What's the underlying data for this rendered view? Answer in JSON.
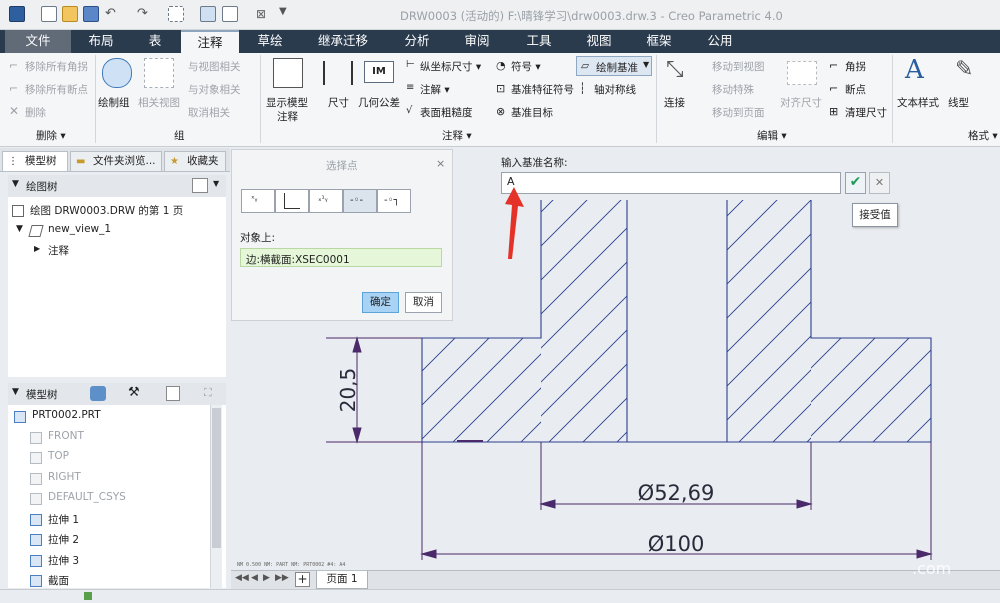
{
  "window": {
    "title": "DRW0003 (活动的) F:\\晴锋学习\\drw0003.drw.3 - Creo Parametric 4.0"
  },
  "tabs": [
    "文件",
    "布局",
    "表",
    "注释",
    "草绘",
    "继承迁移",
    "分析",
    "审阅",
    "工具",
    "视图",
    "框架",
    "公用"
  ],
  "active_tab": "注释",
  "ribbon": {
    "delete_group": {
      "remove_all_angles": "移除所有角拐",
      "remove_all_breaks": "移除所有断点",
      "delete": "删除",
      "label": "删除"
    },
    "group_group": {
      "draw_group": "绘制组",
      "related_view": "相关视图",
      "view_related": "与视图相关",
      "object_related": "与对象相关",
      "cancel_related": "取消相关",
      "label": "组"
    },
    "annotation_group": {
      "show_model_annot_1": "显示模型",
      "show_model_annot_2": "注释",
      "dimension": "尺寸",
      "geometric_tolerance": "几何公差",
      "ordinate_dim": "纵坐标尺寸",
      "annotate": "注解",
      "surface_finish": "表面粗糙度",
      "symbol": "符号",
      "datum_feature_symbol": "基准特征符号",
      "datum_target": "基准目标",
      "draw_datum": "绘制基准",
      "axis_symmetry_line": "轴对称线",
      "label": "注释"
    },
    "edit_group": {
      "connect": "连接",
      "move_to_view": "移动到视图",
      "move_special": "移动特殊",
      "move_to_page": "移动到页面",
      "align_dim": "对齐尺寸",
      "corner": "角拐",
      "breakpoint": "断点",
      "clean_dim": "清理尺寸",
      "label": "编辑"
    },
    "format_group": {
      "text_style": "文本样式",
      "line_type": "线型",
      "label": "格式"
    }
  },
  "left_panel": {
    "tabs": [
      "模型树",
      "文件夹浏览...",
      "收藏夹"
    ],
    "drawing_tree_title": "绘图树",
    "drawing_tree": [
      "绘图 DRW0003.DRW 的第 1 页",
      "new_view_1",
      "注释"
    ],
    "model_tree_title": "模型树",
    "model_tree": [
      {
        "label": "PRT0002.PRT",
        "gray": false
      },
      {
        "label": "FRONT",
        "gray": true
      },
      {
        "label": "TOP",
        "gray": true
      },
      {
        "label": "RIGHT",
        "gray": true
      },
      {
        "label": "DEFAULT_CSYS",
        "gray": true
      },
      {
        "label": "拉伸 1",
        "gray": false
      },
      {
        "label": "拉伸 2",
        "gray": false
      },
      {
        "label": "拉伸 3",
        "gray": false
      },
      {
        "label": "截面",
        "gray": false
      }
    ]
  },
  "select_point_dialog": {
    "title": "选择点",
    "on_object_label": "对象上:",
    "object_value": "边:横截面:XSEC0001",
    "ok": "确定",
    "cancel": "取消"
  },
  "datum_prompt": {
    "label": "输入基准名称:",
    "value": "A",
    "tooltip": "接受值"
  },
  "drawing": {
    "dim_height": "20,5",
    "dim_inner": "Ø52,69",
    "dim_outer": "Ø100",
    "small_text": "NM  0.500   NM: PART   NM: PRT0002   #4: A4",
    "line_color": "#2a3f8f",
    "dim_color": "#4a2a6a"
  },
  "page_bar": {
    "page_tab": "页面 1"
  },
  "watermark": ".com"
}
